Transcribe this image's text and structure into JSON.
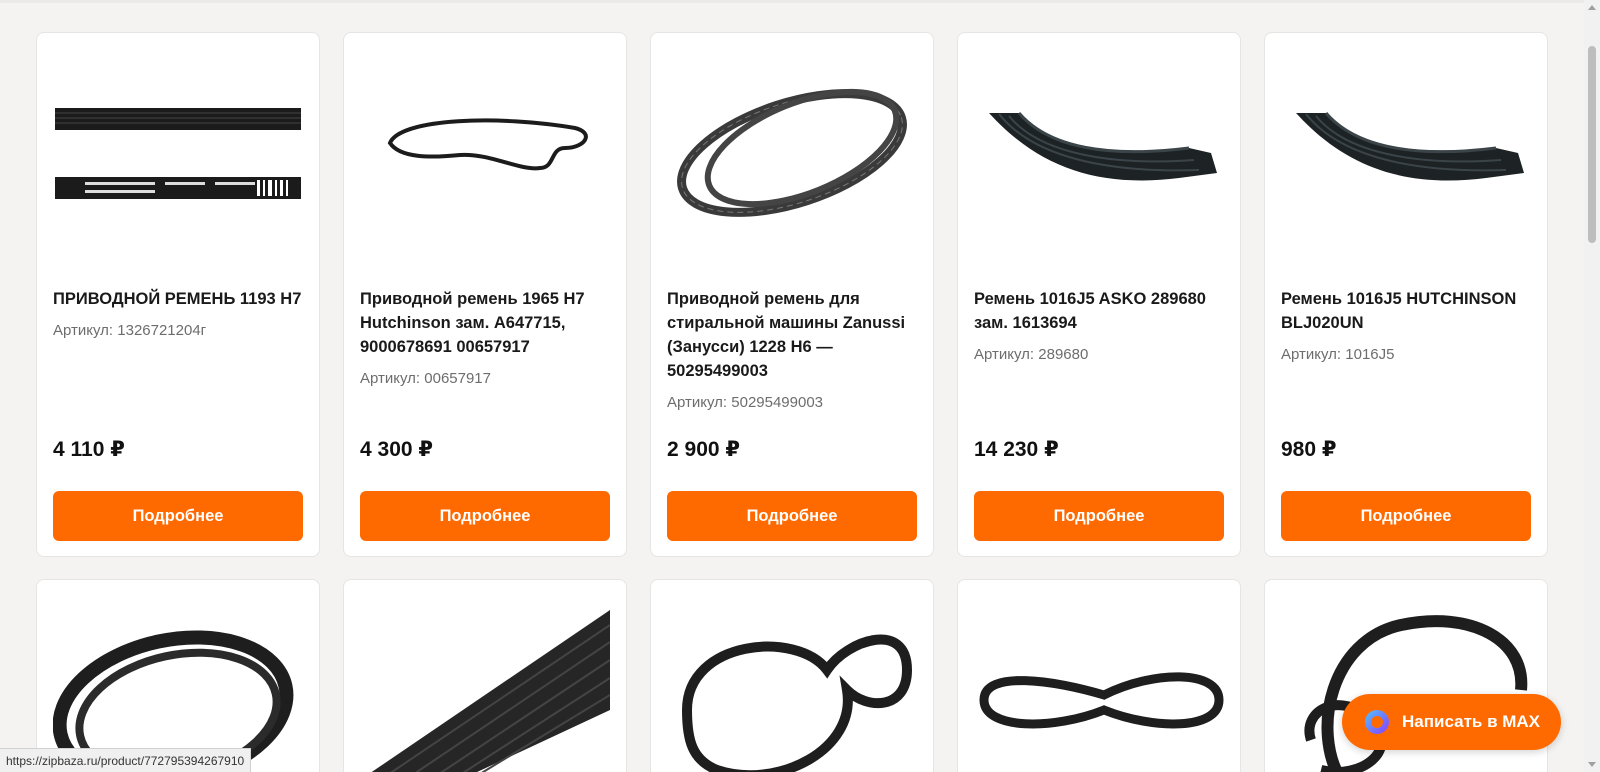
{
  "products": [
    {
      "title": "ПРИВОДНОЙ РЕМЕНЬ 1193 H7",
      "sku": "Артикул: 1326721204г",
      "price": "4 110 ₽",
      "button": "Подробнее",
      "image": "belt-strip-icon"
    },
    {
      "title": "Приводной ремень 1965 H7 Hutchinson зам. A647715, 9000678691 00657917",
      "sku": "Артикул: 00657917",
      "price": "4 300 ₽",
      "button": "Подробнее",
      "image": "belt-loop-icon"
    },
    {
      "title": "Приводной ремень для стиральной машины Zanussi (Занусси) 1228 H6 — 50295499003",
      "sku": "Артикул: 50295499003",
      "price": "2 900 ₽",
      "button": "Подробнее",
      "image": "belt-loop-icon"
    },
    {
      "title": "Ремень 1016J5 ASKO 289680 зам. 1613694",
      "sku": "Артикул: 289680",
      "price": "14 230 ₽",
      "button": "Подробнее",
      "image": "belt-segment-icon"
    },
    {
      "title": "Ремень 1016J5 HUTCHINSON BLJ020UN",
      "sku": "Артикул: 1016J5",
      "price": "980 ₽",
      "button": "Подробнее",
      "image": "belt-segment-icon"
    }
  ],
  "row2_images": [
    "belt-coil-icon",
    "belt-ribbed-icon",
    "belt-loop-icon",
    "belt-loop-icon",
    "belt-coil-icon"
  ],
  "status_url": "https://zipbaza.ru/product/772795394267910",
  "chat_button": {
    "label": "Написать в MAX",
    "color": "#ff6a00"
  },
  "colors": {
    "accent": "#ff6a00",
    "background": "#f4f3f1"
  }
}
